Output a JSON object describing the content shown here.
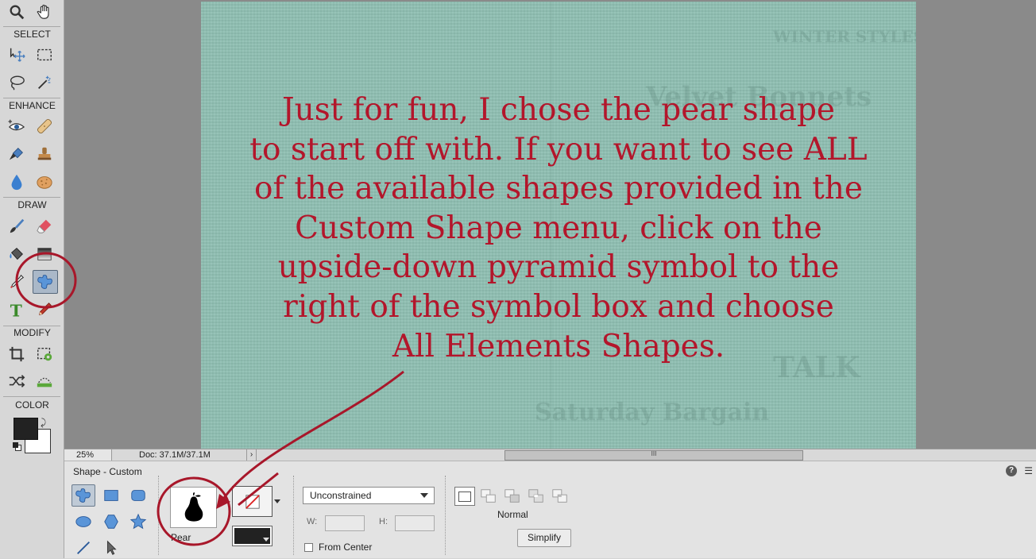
{
  "toolbox": {
    "sections": {
      "select": "SELECT",
      "enhance": "ENHANCE",
      "draw": "DRAW",
      "modify": "MODIFY",
      "color": "COLOR"
    }
  },
  "canvas": {
    "background_color": "#8fbfb2",
    "instruction_lines": [
      "Just for fun, I chose the pear shape",
      "to start off with. If you want to see ALL",
      "of the available shapes provided in the",
      "Custom Shape menu, click on the",
      "upside-down pyramid symbol to the",
      "right of the symbol box and choose",
      "All Elements Shapes."
    ],
    "text_color": "#b3162b"
  },
  "statusbar": {
    "zoom": "25%",
    "doc_size": "Doc: 37.1M/37.1M",
    "arrow": "›",
    "scroll_grip": "III"
  },
  "options": {
    "title": "Shape - Custom",
    "help": "?",
    "panel_menu": "☰",
    "shape_name": "Pear",
    "constraint": "Unconstrained",
    "w_label": "W:",
    "h_label": "H:",
    "from_center": "From Center",
    "mode": "Normal",
    "simplify": "Simplify"
  },
  "annotation_color": "#a8172a"
}
